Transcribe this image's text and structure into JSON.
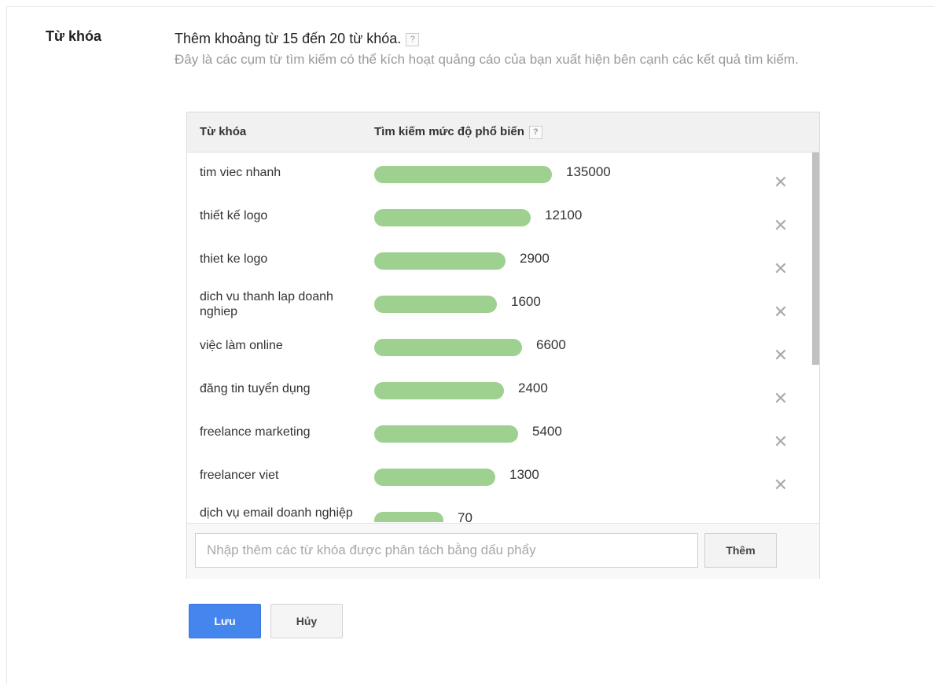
{
  "section_label": "Từ khóa",
  "intro": {
    "title": "Thêm khoảng từ 15 đến 20 từ khóa.",
    "help_mark": "?",
    "description": "Đây là các cụm từ tìm kiếm có thể kích hoạt quảng cáo của bạn xuất hiện bên cạnh các kết quả tìm kiếm."
  },
  "table": {
    "col_keyword": "Từ khóa",
    "col_popularity": "Tìm kiếm mức độ phổ biến",
    "help_mark": "?",
    "remove_symbol": "✕",
    "rows": [
      {
        "keyword": "tim viec nhanh",
        "volume": "135000",
        "bar_fraction": 1.0
      },
      {
        "keyword": "thiết kế logo",
        "volume": "12100",
        "bar_fraction": 0.88
      },
      {
        "keyword": "thiet ke logo",
        "volume": "2900",
        "bar_fraction": 0.74
      },
      {
        "keyword": "dich vu thanh lap doanh nghiep",
        "volume": "1600",
        "bar_fraction": 0.69
      },
      {
        "keyword": "việc làm online",
        "volume": "6600",
        "bar_fraction": 0.83
      },
      {
        "keyword": "đăng tin tuyển dụng",
        "volume": "2400",
        "bar_fraction": 0.73
      },
      {
        "keyword": "freelance marketing",
        "volume": "5400",
        "bar_fraction": 0.81
      },
      {
        "keyword": "freelancer viet",
        "volume": "1300",
        "bar_fraction": 0.68
      },
      {
        "keyword": "dịch vụ email doanh nghiệp",
        "volume": "70",
        "bar_fraction": 0.39
      }
    ]
  },
  "add_keywords": {
    "placeholder": "Nhập thêm các từ khóa được phân tách bằng dấu phẩy",
    "button_label": "Thêm"
  },
  "actions": {
    "save_label": "Lưu",
    "cancel_label": "Hủy"
  },
  "colors": {
    "bar": "#9ed08f",
    "save_button": "#4485ee"
  }
}
